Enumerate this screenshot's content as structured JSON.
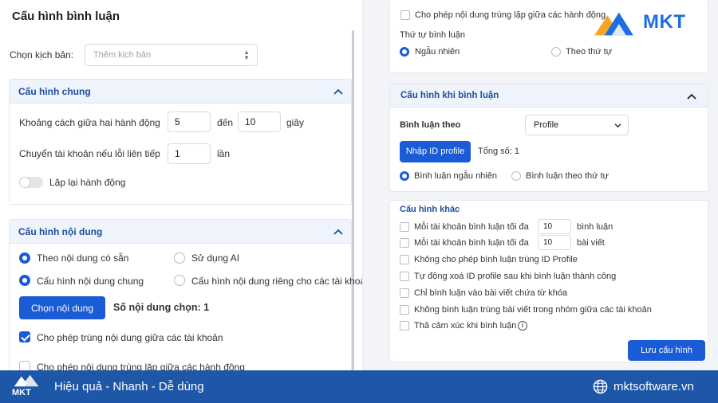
{
  "page": {
    "title": "Cấu hình bình luận"
  },
  "script": {
    "label": "Chọn kịch bản:",
    "placeholder": "Thêm kịch bản"
  },
  "general": {
    "title": "Cấu hình chung",
    "interval_label": "Khoảng cách giữa hai hành động",
    "interval_from": "5",
    "interval_to_label": "đến",
    "interval_to": "10",
    "interval_unit": "giây",
    "switch_label": "Chuyển tài khoản nếu lỗi liên tiếp",
    "switch_value": "1",
    "switch_unit": "lần",
    "repeat_label": "Lặp lại hành động"
  },
  "content": {
    "title": "Cấu hình nội dung",
    "opt_existing": "Theo nội dung có sẵn",
    "opt_ai": "Sử dụng AI",
    "opt_common": "Cấu hình nội dung chung",
    "opt_private": "Cấu hình nội dung riêng cho các tài khoản",
    "choose_btn": "Chọn nội dung",
    "count_text": "Số nội dung chọn: 1",
    "allow_dup_accounts": "Cho phép trùng nội dung giữa các tài khoản",
    "allow_dup_actions": "Cho phép nội dung trùng lặp giữa các hành động"
  },
  "right_top": {
    "allow_dup_actions": "Cho phép nội dung trùng lặp giữa các hành động",
    "order_label": "Thứ tự bình luận",
    "order_random": "Ngẫu nhiên",
    "order_sequence": "Theo thứ tự"
  },
  "comment_when": {
    "title": "Cấu hình khi bình luận",
    "by_label": "Bình luận theo",
    "by_value": "Profile",
    "import_btn": "Nhập ID profile",
    "total": "Tổng số: 1",
    "random": "Bình luận ngẫu nhiên",
    "sequence": "Bình luận theo thứ tự"
  },
  "other": {
    "title": "Cấu hình khác",
    "max_comment_label": "Mỗi tài khoản bình luận tối đa",
    "max_comment_value": "10",
    "max_comment_unit": "bình luận",
    "max_post_label": "Mỗi tài khoản bình luận tối đa",
    "max_post_value": "10",
    "max_post_unit": "bài viết",
    "no_dup_profile": "Không cho phép bình luận trùng ID Profile",
    "auto_delete": "Tự động xoá ID profile sau khi bình luận thành công",
    "only_keyword": "Chỉ bình luận vào bài viết chứa từ khóa",
    "no_dup_group": "Không bình luận trùng bài viết trong nhóm giữa các tài khoản",
    "react": "Thả cảm xúc khi bình luận",
    "save_btn": "Lưu cấu hình"
  },
  "brand": {
    "logo_text": "MKT",
    "slogan": "Hiệu quả - Nhanh - Dễ dùng",
    "site": "mktsoftware.vn"
  },
  "colors": {
    "accent": "#1a5bd6",
    "footer": "#1e56a8",
    "header_bg": "#eef3fc"
  }
}
